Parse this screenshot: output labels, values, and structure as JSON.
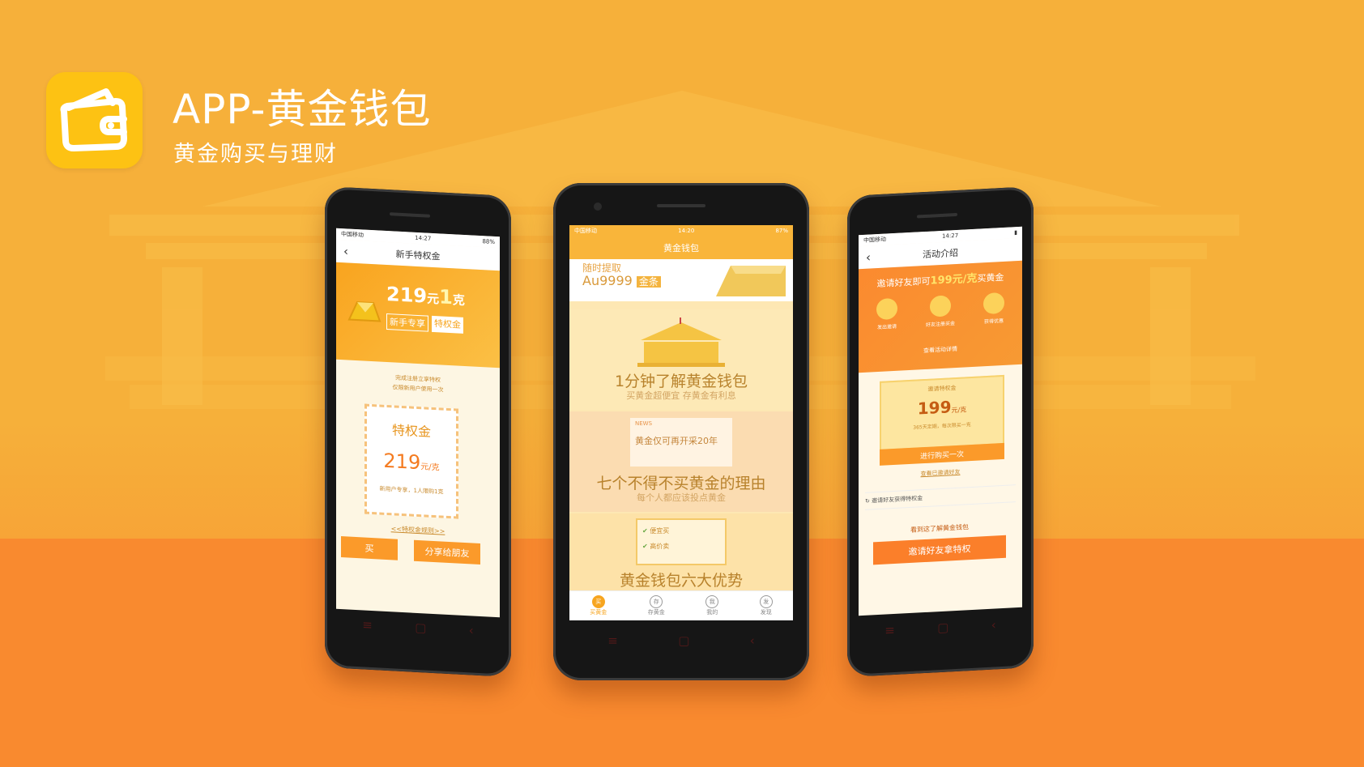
{
  "colors": {
    "accent": "#f7a51f",
    "background": "#f6b03a",
    "floor": "#f98a2f"
  },
  "header": {
    "icon": "wallet-icon",
    "title": "APP-黄金钱包",
    "subtitle": "黄金购买与理财"
  },
  "phone_left": {
    "status_carrier": "中国移动",
    "status_time": "14:27",
    "status_battery": "88%",
    "nav_title": "新手特权金",
    "banner_price": "219",
    "banner_unit": "元",
    "banner_qty": "1",
    "banner_qty_unit": "克",
    "banner_tag1": "新手专享",
    "banner_tag2": "特权金",
    "intro_line1": "完成注册立享特权",
    "intro_line2": "仅限新用户使用一次",
    "card_title": "特权金",
    "card_price": "219",
    "card_unit": "元/克",
    "card_note": "新用户专享，1人限购1克",
    "rules_link": "<<特权金规则>>",
    "button_left": "买",
    "button_right": "分享给朋友"
  },
  "phone_center": {
    "status_carrier": "中国移动",
    "status_time": "14:20",
    "status_battery": "87%",
    "nav_title": "黄金钱包",
    "hero_line1": "随时提取",
    "hero_code": "Au9999",
    "hero_tag": "金条",
    "tile1_title": "1分钟了解黄金钱包",
    "tile1_sub": "买黄金超便宜 存黄金有利息",
    "tile2_news": "NEWS",
    "tile2_headline": "黄金仅可再开采20年",
    "tile2_title": "七个不得不买黄金的理由",
    "tile2_sub": "每个人都应该投点黄金",
    "tile3_check1": "便宜买",
    "tile3_check2": "高价卖",
    "tile3_title": "黄金钱包六大优势",
    "tabs": [
      {
        "icon": "buy-icon",
        "glyph": "买",
        "label": "买黄金"
      },
      {
        "icon": "deposit-icon",
        "glyph": "存",
        "label": "存黄金"
      },
      {
        "icon": "profile-icon",
        "glyph": "我",
        "label": "我的"
      },
      {
        "icon": "discover-icon",
        "glyph": "发",
        "label": "发现"
      }
    ]
  },
  "phone_right": {
    "status_carrier": "中国移动",
    "status_time": "14:27",
    "nav_title": "活动介绍",
    "banner_text_pre": "邀请好友即可",
    "banner_price": "199元/克",
    "banner_text_post": "买黄金",
    "step1": "发出邀请",
    "step2": "好友注册买金",
    "step3": "获得优惠",
    "step_link": "查看活动详情",
    "card_label": "邀请特权金",
    "card_price": "199",
    "card_unit": "元/克",
    "card_note": "365天定期，每次限买一克",
    "card_button": "进行购买一次",
    "invite_link": "查看已邀请好友",
    "list_item": "邀请好友获得特权金",
    "learn_link": "看到这了解黄金钱包",
    "invite_button": "邀请好友拿特权"
  }
}
